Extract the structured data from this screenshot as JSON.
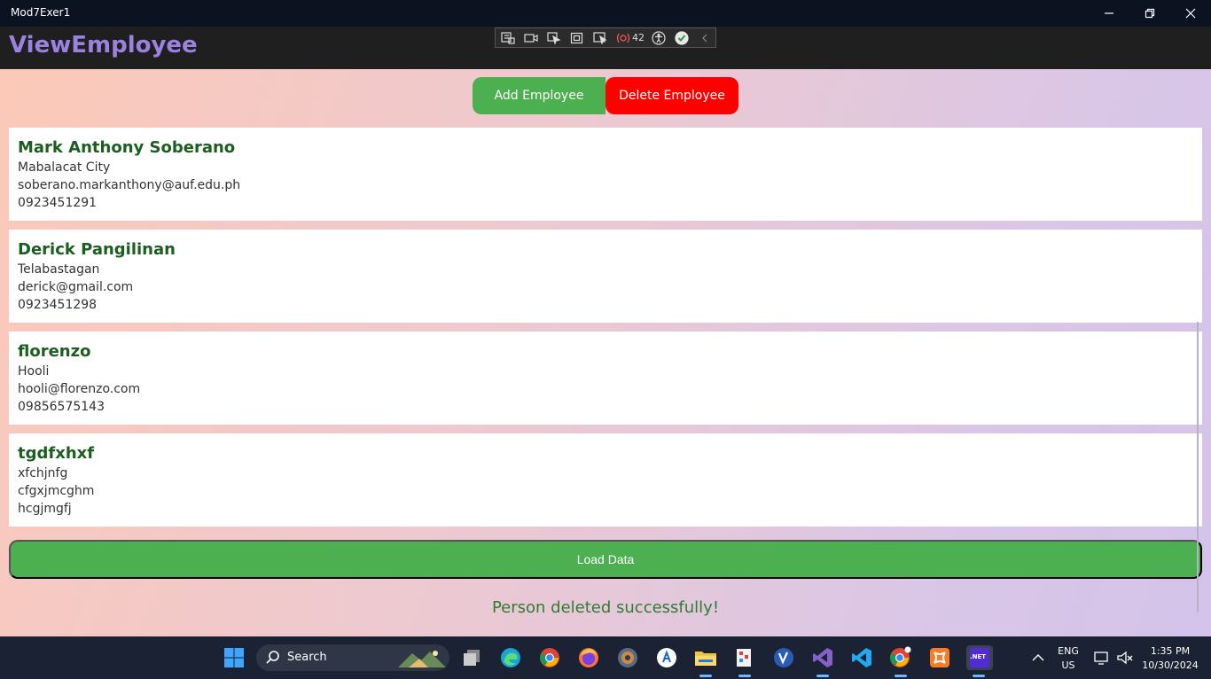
{
  "window": {
    "title": "Mod7Exer1"
  },
  "app": {
    "title": "ViewEmployee"
  },
  "debug_toolbar": {
    "count": "42"
  },
  "buttons": {
    "add": "Add Employee",
    "delete": "Delete Employee",
    "load": "Load Data"
  },
  "employees": [
    {
      "name": "Mark Anthony Soberano",
      "address": "Mabalacat City",
      "email": "soberano.markanthony@auf.edu.ph",
      "phone": "0923451291"
    },
    {
      "name": "Derick Pangilinan",
      "address": "Telabastagan",
      "email": "derick@gmail.com",
      "phone": "0923451298"
    },
    {
      "name": "florenzo",
      "address": "Hooli",
      "email": "hooli@florenzo.com",
      "phone": "09856575143"
    },
    {
      "name": "tgdfxhxf",
      "address": "xfchjnfg",
      "email": "cfgxjmcghm",
      "phone": "hcgjmgfj"
    }
  ],
  "status_message": "Person deleted successfully!",
  "taskbar": {
    "search_label": "Search",
    "lang": "ENG",
    "region": "US",
    "time": "1:35 PM",
    "date": "10/30/2024",
    "net_label": ".NET"
  },
  "colors": {
    "primary_green": "#4caf50",
    "danger_red": "#ff0000",
    "name_green": "#1b5e20",
    "title_purple": "#9b82e0"
  }
}
